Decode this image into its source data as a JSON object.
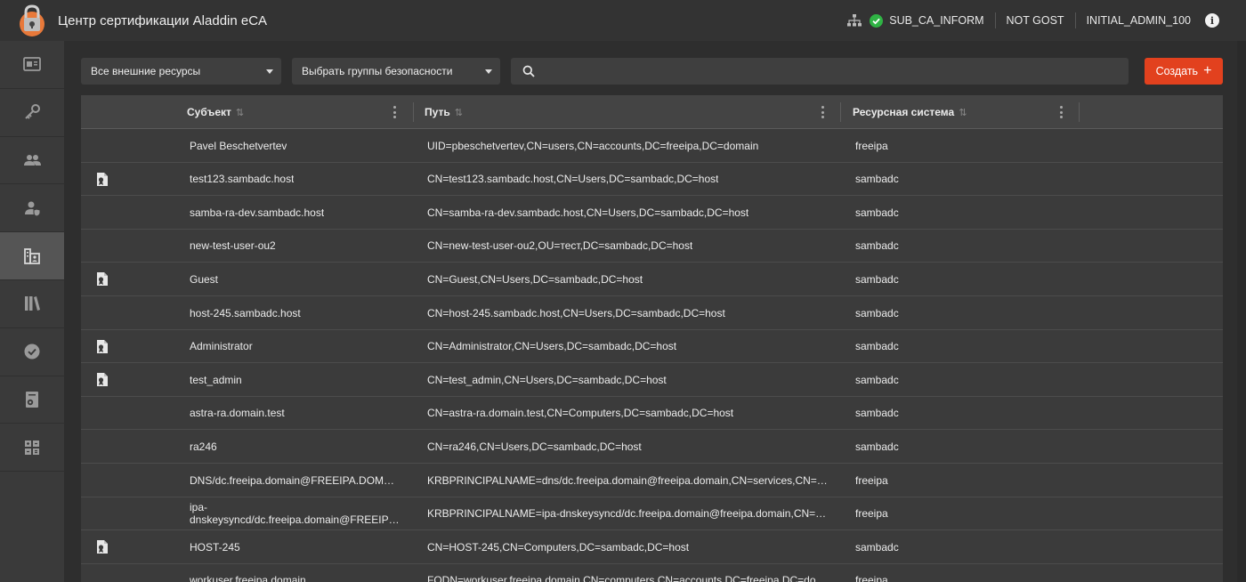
{
  "header": {
    "app_title": "Центр сертификации Aladdin eCA",
    "ca_name": "SUB_CA_INFORM",
    "mode": "NOT GOST",
    "user": "INITIAL_ADMIN_100",
    "status_color": "#2fb344"
  },
  "sidebar": {
    "items": [
      {
        "icon": "certificate-card-icon"
      },
      {
        "icon": "key-icon"
      },
      {
        "icon": "users-icon"
      },
      {
        "icon": "user-shield-icon"
      },
      {
        "icon": "resource-subjects-icon",
        "active": true
      },
      {
        "icon": "books-icon"
      },
      {
        "icon": "check-badge-icon"
      },
      {
        "icon": "document-gear-icon"
      },
      {
        "icon": "calculator-icon"
      }
    ]
  },
  "filters": {
    "resources_select": "Все внешние ресурсы",
    "groups_select": "Выбрать группы безопасности",
    "search_placeholder": "",
    "create_label": "Создать"
  },
  "table": {
    "columns": [
      "Субъект",
      "Путь",
      "Ресурсная система"
    ],
    "rows": [
      {
        "icon": false,
        "subject": "Pavel Beschetvertev",
        "path": "UID=pbeschetvertev,CN=users,CN=accounts,DC=freeipa,DC=domain",
        "system": "freeipa"
      },
      {
        "icon": true,
        "subject": "test123.sambadc.host",
        "path": "CN=test123.sambadc.host,CN=Users,DC=sambadc,DC=host",
        "system": "sambadc"
      },
      {
        "icon": false,
        "subject": "samba-ra-dev.sambadc.host",
        "path": "CN=samba-ra-dev.sambadc.host,CN=Users,DC=sambadc,DC=host",
        "system": "sambadc"
      },
      {
        "icon": false,
        "subject": "new-test-user-ou2",
        "path": "CN=new-test-user-ou2,OU=тест,DC=sambadc,DC=host",
        "system": "sambadc"
      },
      {
        "icon": true,
        "subject": "Guest",
        "path": "CN=Guest,CN=Users,DC=sambadc,DC=host",
        "system": "sambadc"
      },
      {
        "icon": false,
        "subject": "host-245.sambadc.host",
        "path": "CN=host-245.sambadc.host,CN=Users,DC=sambadc,DC=host",
        "system": "sambadc"
      },
      {
        "icon": true,
        "subject": "Administrator",
        "path": "CN=Administrator,CN=Users,DC=sambadc,DC=host",
        "system": "sambadc"
      },
      {
        "icon": true,
        "subject": "test_admin",
        "path": "CN=test_admin,CN=Users,DC=sambadc,DC=host",
        "system": "sambadc"
      },
      {
        "icon": false,
        "subject": "astra-ra.domain.test",
        "path": "CN=astra-ra.domain.test,CN=Computers,DC=sambadc,DC=host",
        "system": "sambadc"
      },
      {
        "icon": false,
        "subject": "ra246",
        "path": "CN=ra246,CN=Users,DC=sambadc,DC=host",
        "system": "sambadc"
      },
      {
        "icon": false,
        "subject": "DNS/dc.freeipa.domain@FREEIPA.DOM…",
        "path": "KRBPRINCIPALNAME=dns/dc.freeipa.domain@freeipa.domain,CN=services,CN=…",
        "system": "freeipa"
      },
      {
        "icon": false,
        "subject": "ipa-dnskeysyncd/dc.freeipa.domain@FREEIP…",
        "path": "KRBPRINCIPALNAME=ipa-dnskeysyncd/dc.freeipa.domain@freeipa.domain,CN=…",
        "system": "freeipa",
        "wrap": true
      },
      {
        "icon": true,
        "subject": "HOST-245",
        "path": "CN=HOST-245,CN=Computers,DC=sambadc,DC=host",
        "system": "sambadc"
      },
      {
        "icon": false,
        "subject": "workuser.freeipa.domain",
        "path": "FQDN=workuser.freeipa.domain,CN=computers,CN=accounts,DC=freeipa,DC=do…",
        "system": "freeipa"
      }
    ]
  }
}
